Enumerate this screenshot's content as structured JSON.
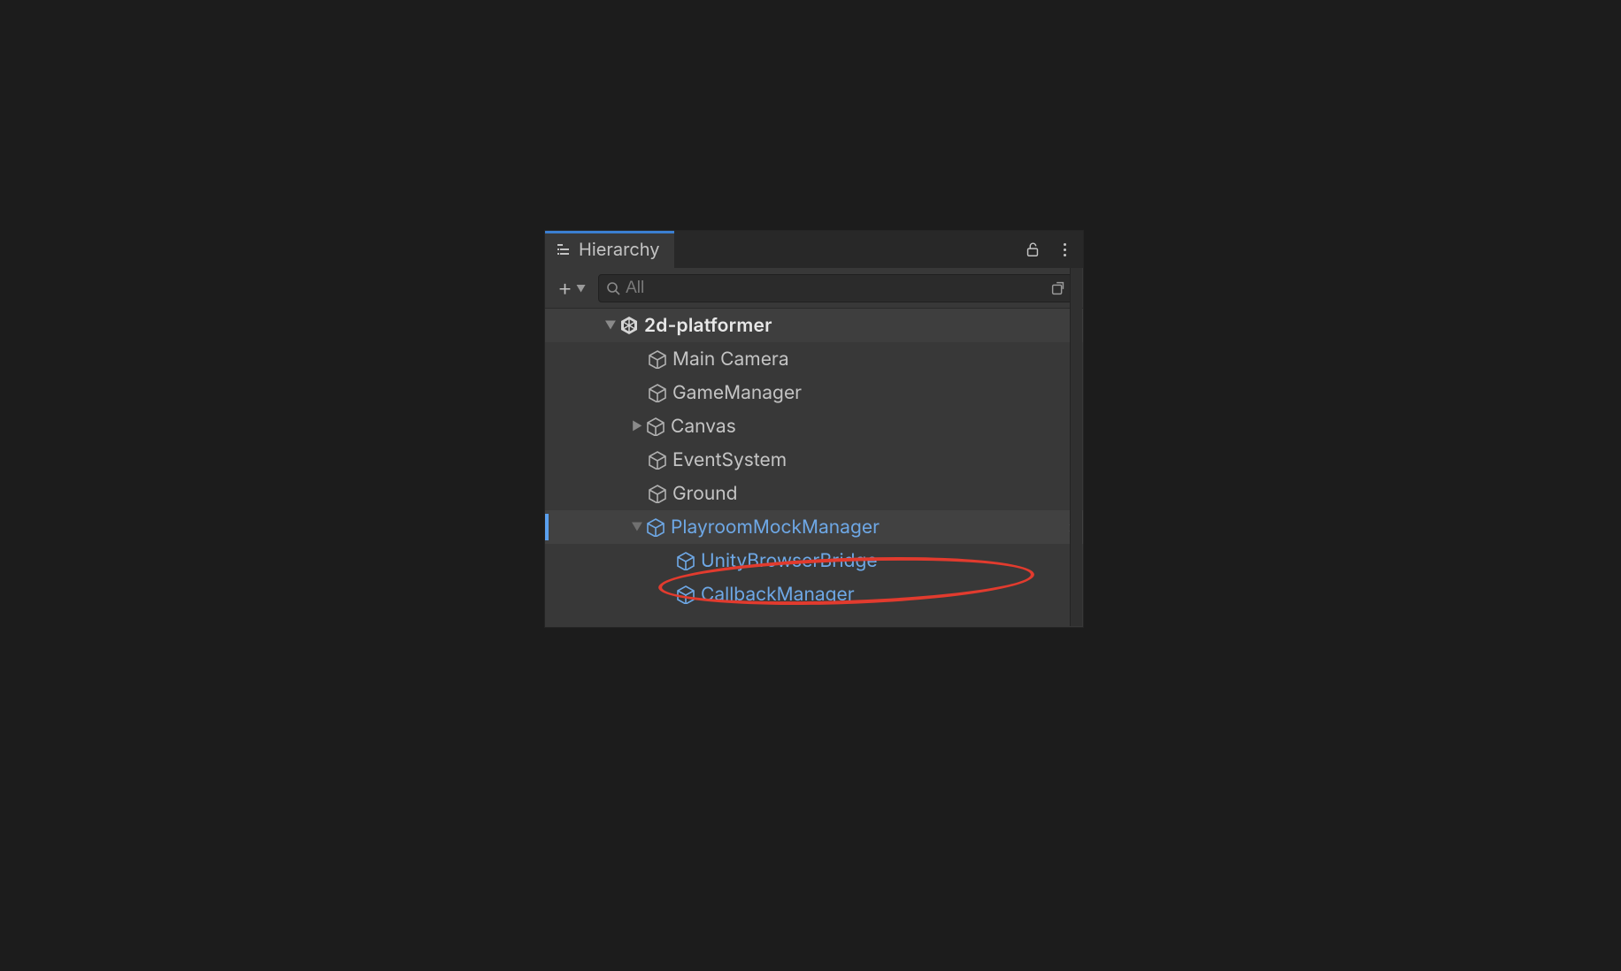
{
  "panel": {
    "tab_label": "Hierarchy"
  },
  "toolbar": {
    "search_placeholder": "All"
  },
  "scene": {
    "name": "2d-platformer"
  },
  "items": {
    "main_camera": "Main Camera",
    "game_manager": "GameManager",
    "canvas": "Canvas",
    "event_system": "EventSystem",
    "ground": "Ground",
    "playroom_mock_manager": "PlayroomMockManager",
    "unity_browser_bridge": "UnityBrowserBridge",
    "callback_manager": "CallbackManager"
  }
}
